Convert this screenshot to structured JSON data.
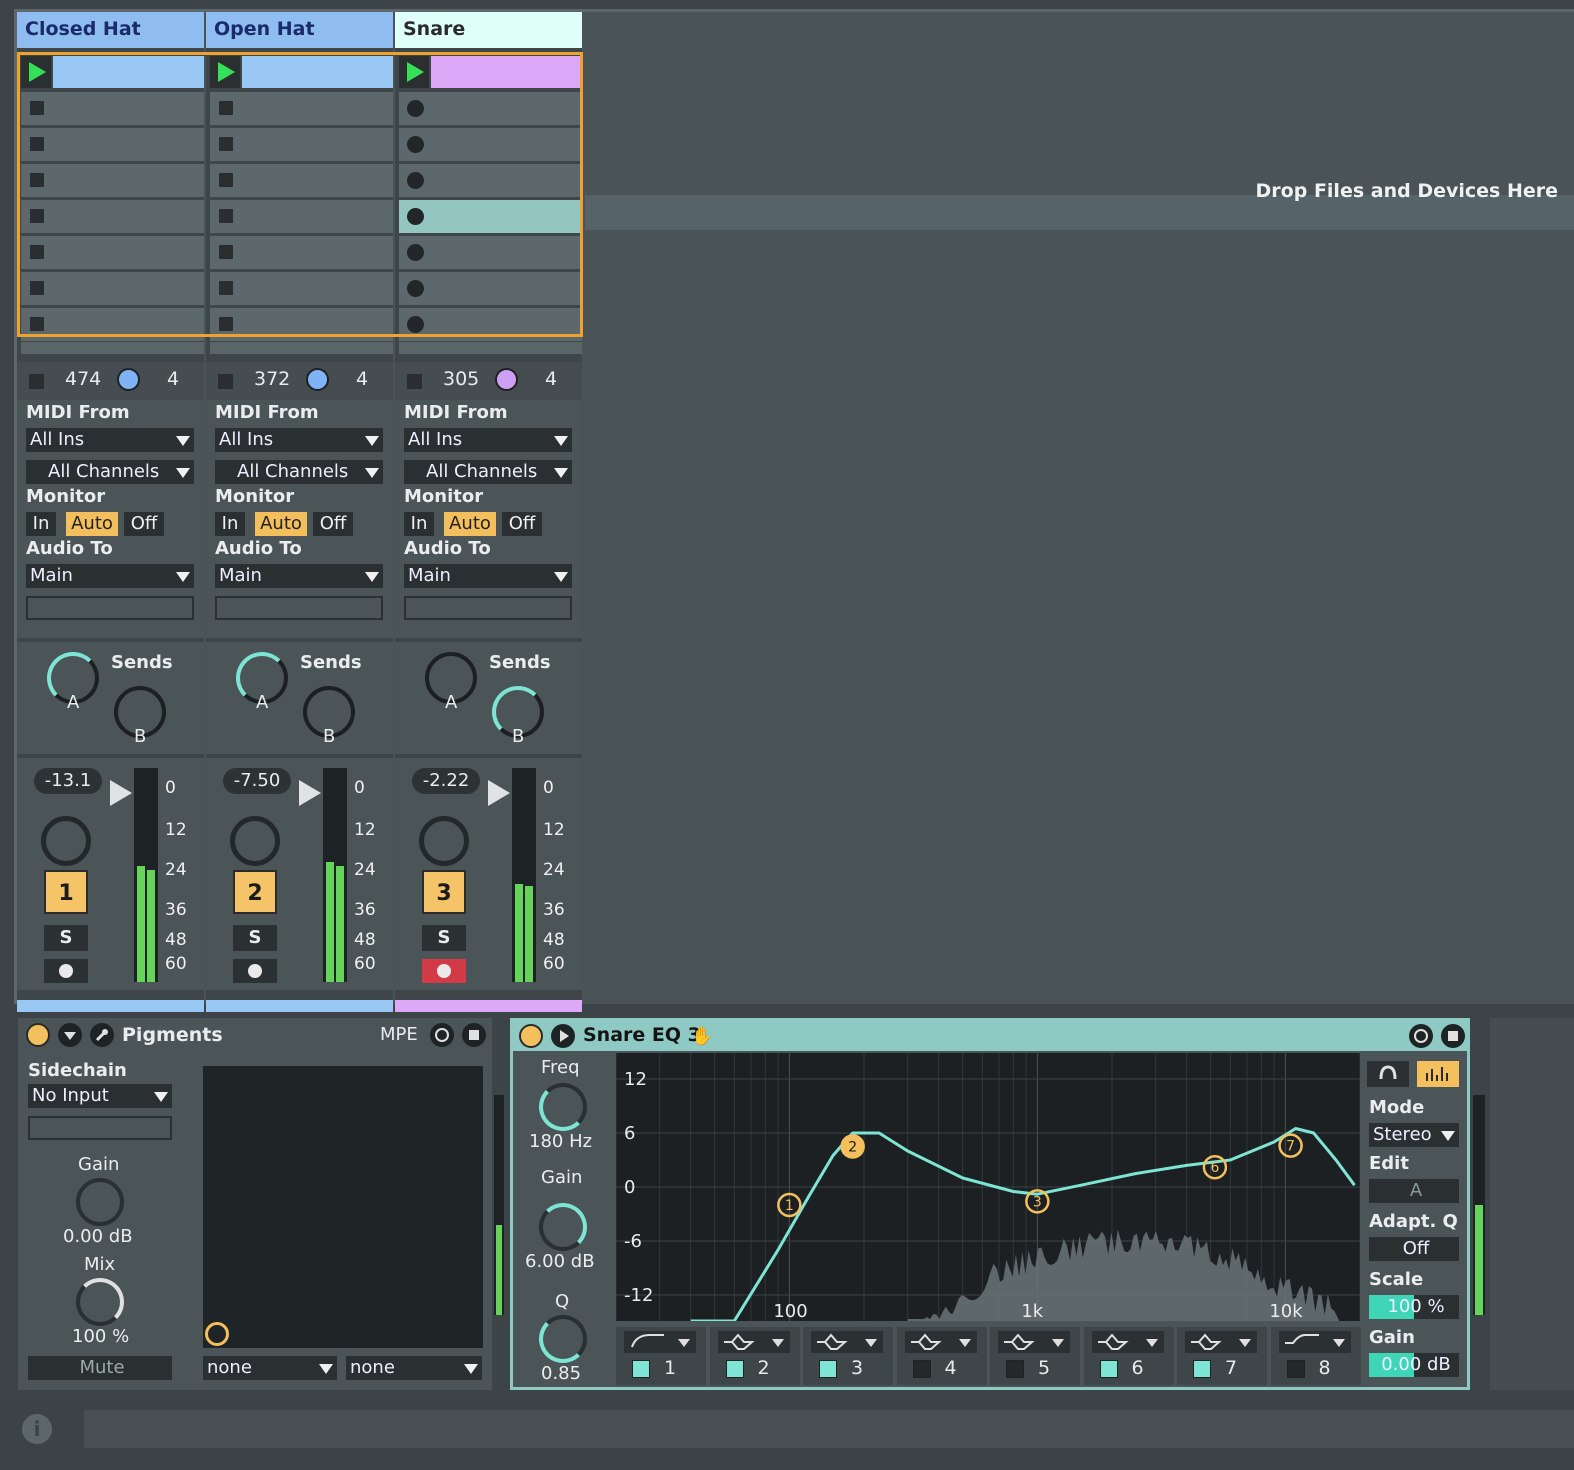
{
  "session": {
    "drop_text": "Drop Files and Devices Here",
    "tracks": [
      {
        "name": "Closed Hat",
        "title_bg": "#8fbdf2",
        "clip_color": "#99c8f5",
        "stat": "474",
        "dot": "#7fb2f7",
        "count": "4",
        "vol": "-13.1",
        "num": "1",
        "armed": false
      },
      {
        "name": "Open Hat",
        "title_bg": "#8fbdf2",
        "clip_color": "#99c8f5",
        "stat": "372",
        "dot": "#7fb2f7",
        "count": "4",
        "vol": "-7.50",
        "num": "2",
        "armed": false
      },
      {
        "name": "Snare",
        "title_bg": "#dffff9",
        "clip_color": "#dca8f7",
        "stat": "305",
        "dot": "#cda0f4",
        "count": "4",
        "vol": "-2.22",
        "num": "3",
        "armed": true
      }
    ],
    "io": {
      "midi_from": "MIDI From",
      "all_ins": "All Ins",
      "all_channels": "All Channels",
      "monitor": "Monitor",
      "mon_in": "In",
      "mon_auto": "Auto",
      "mon_off": "Off",
      "audio_to": "Audio To",
      "main": "Main"
    },
    "sends": {
      "label": "Sends",
      "a": "A",
      "b": "B"
    },
    "solo": "S",
    "scale": [
      "0",
      "12",
      "24",
      "36",
      "48",
      "60"
    ]
  },
  "pigments": {
    "title": "Pigments",
    "mpe": "MPE",
    "sidechain": "Sidechain",
    "input": "No Input",
    "gain_label": "Gain",
    "gain_value": "0.00 dB",
    "mix_label": "Mix",
    "mix_value": "100 %",
    "mute": "Mute",
    "sel1": "none",
    "sel2": "none"
  },
  "eq": {
    "title": "Snare EQ 3",
    "freq_label": "Freq",
    "freq_value": "180 Hz",
    "gain_label": "Gain",
    "gain_value": "6.00 dB",
    "q_label": "Q",
    "q_value": "0.85",
    "y_ticks": [
      "12",
      "6",
      "0",
      "-6",
      "-12"
    ],
    "x_ticks": [
      "100",
      "1k",
      "10k"
    ],
    "bands": [
      "1",
      "2",
      "3",
      "4",
      "5",
      "6",
      "7",
      "8"
    ],
    "band_on": [
      true,
      true,
      true,
      false,
      false,
      true,
      true,
      false
    ],
    "nodes": [
      "1",
      "2",
      "3",
      "6",
      "7"
    ],
    "mode_label": "Mode",
    "mode_value": "Stereo",
    "edit_label": "Edit",
    "edit_value": "A",
    "adaptq_label": "Adapt. Q",
    "adaptq_value": "Off",
    "scale_label": "Scale",
    "scale_value": "100 %",
    "scale_level": 0.5,
    "gain2_label": "Gain",
    "gain2_value": "0.00 dB",
    "gain2_level": 0.5
  }
}
